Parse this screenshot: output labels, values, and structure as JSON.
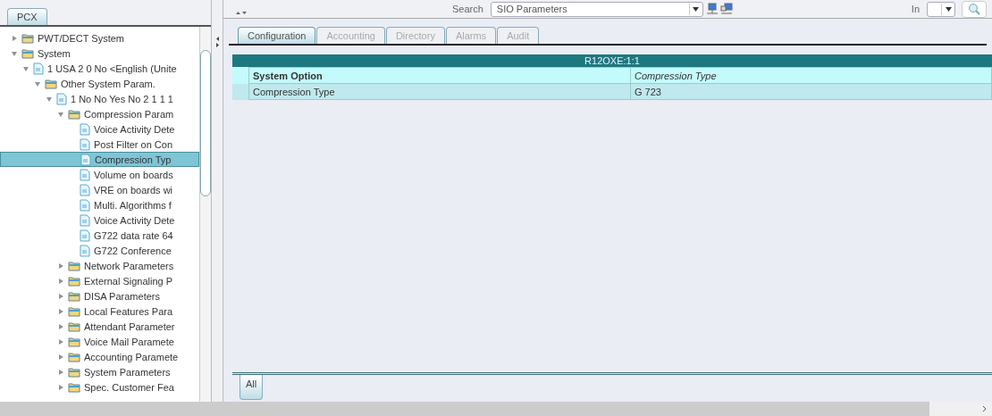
{
  "left_tabs": [
    {
      "label": "PCX",
      "selected": true
    }
  ],
  "tree": [
    {
      "label": "PWT/DECT System",
      "kind": "folder",
      "expanded": false,
      "selected": false
    },
    {
      "label": "System",
      "kind": "folder",
      "expanded": true,
      "selected": false,
      "children": [
        {
          "label": "1 USA 2 0 No <English (Unite",
          "kind": "record",
          "expanded": true,
          "selected": false,
          "children": [
            {
              "label": "Other System Param.",
              "kind": "folder",
              "expanded": true,
              "selected": false,
              "children": [
                {
                  "label": "1 No No Yes No 2 1 1 1",
                  "kind": "record",
                  "expanded": true,
                  "selected": false,
                  "children": [
                    {
                      "label": "Compression Param",
                      "kind": "folder",
                      "expanded": true,
                      "selected": false,
                      "children": [
                        {
                          "label": "Voice Activity Dete",
                          "kind": "record",
                          "selected": false
                        },
                        {
                          "label": "Post Filter on Con",
                          "kind": "record",
                          "selected": false
                        },
                        {
                          "label": "Compression Typ",
                          "kind": "record",
                          "selected": true
                        },
                        {
                          "label": "Volume on boards",
                          "kind": "record",
                          "selected": false
                        },
                        {
                          "label": "VRE on boards wi",
                          "kind": "record",
                          "selected": false
                        },
                        {
                          "label": "Multi. Algorithms f",
                          "kind": "record",
                          "selected": false
                        },
                        {
                          "label": "Voice Activity Dete",
                          "kind": "record",
                          "selected": false
                        },
                        {
                          "label": "G722 data rate 64",
                          "kind": "record",
                          "selected": false
                        },
                        {
                          "label": "G722 Conference",
                          "kind": "record",
                          "selected": false
                        }
                      ]
                    },
                    {
                      "label": "Network Parameters",
                      "kind": "folder",
                      "expanded": false,
                      "selected": false
                    },
                    {
                      "label": "External Signaling P",
                      "kind": "folder",
                      "expanded": false,
                      "selected": false
                    },
                    {
                      "label": "DISA Parameters",
                      "kind": "folder",
                      "expanded": false,
                      "selected": false
                    },
                    {
                      "label": "Local Features Para",
                      "kind": "folder",
                      "expanded": false,
                      "selected": false
                    },
                    {
                      "label": "Attendant Parameter",
                      "kind": "folder",
                      "expanded": false,
                      "selected": false
                    },
                    {
                      "label": "Voice Mail Paramete",
                      "kind": "folder",
                      "expanded": false,
                      "selected": false
                    },
                    {
                      "label": "Accounting Paramete",
                      "kind": "folder",
                      "expanded": false,
                      "selected": false
                    },
                    {
                      "label": "System Parameters",
                      "kind": "folder",
                      "expanded": false,
                      "selected": false
                    },
                    {
                      "label": "Spec. Customer Fea",
                      "kind": "folder",
                      "expanded": false,
                      "selected": false
                    }
                  ]
                }
              ]
            }
          ]
        }
      ]
    }
  ],
  "search": {
    "label": "Search",
    "value": "SIO Parameters",
    "in_label": "In"
  },
  "tabs": [
    {
      "label": "Configuration",
      "selected": true,
      "disabled": false
    },
    {
      "label": "Accounting",
      "selected": false,
      "disabled": true
    },
    {
      "label": "Directory",
      "selected": false,
      "disabled": true
    },
    {
      "label": "Alarms",
      "selected": false,
      "disabled": true
    },
    {
      "label": "Audit",
      "selected": false,
      "disabled": true
    }
  ],
  "table": {
    "title": "R12OXE:1:1",
    "columns": [
      "System Option",
      "Compression Type"
    ],
    "rows": [
      [
        "Compression Type",
        "G 723"
      ]
    ]
  },
  "bottom_tabs": [
    {
      "label": "All",
      "selected": true
    }
  ]
}
